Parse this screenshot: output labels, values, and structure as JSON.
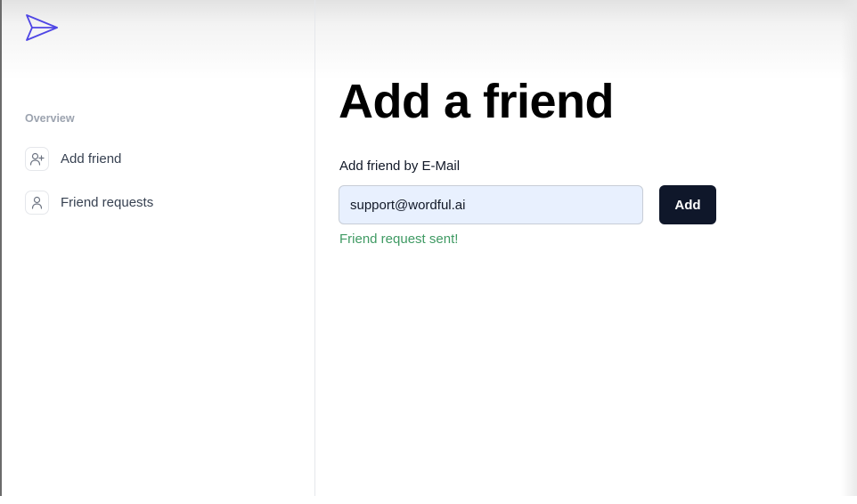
{
  "sidebar": {
    "logo_icon": "paper-plane-icon",
    "section_label": "Overview",
    "items": [
      {
        "label": "Add friend",
        "icon": "user-plus-icon"
      },
      {
        "label": "Friend requests",
        "icon": "user-icon"
      }
    ]
  },
  "main": {
    "title": "Add a friend",
    "field_label": "Add friend by E-Mail",
    "email_value": "support@wordful.ai",
    "add_button_label": "Add",
    "status_message": "Friend request sent!"
  },
  "colors": {
    "accent": "#4f46e5",
    "button_bg": "#0f172a",
    "success": "#3f9a63",
    "input_autofill_bg": "#e8f0fe"
  }
}
